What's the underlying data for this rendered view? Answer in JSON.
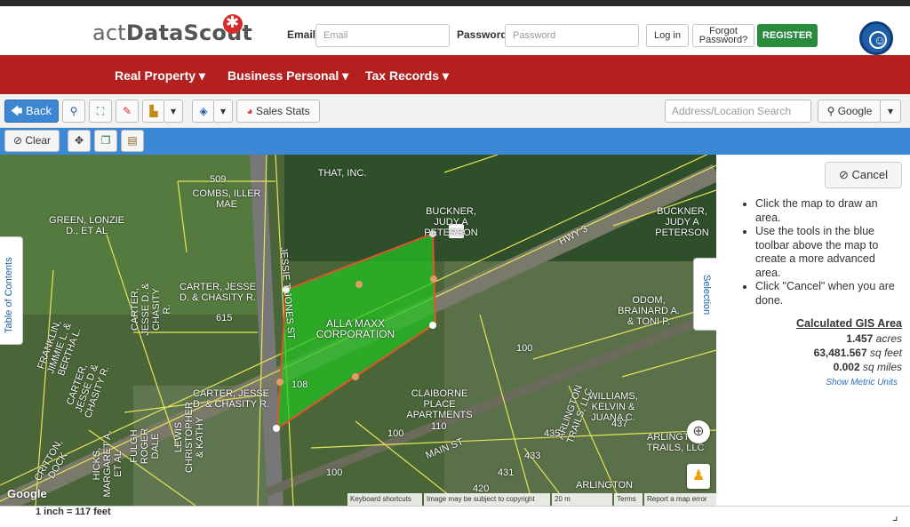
{
  "header": {
    "logo_prefix": "act",
    "logo_main": "DataScout",
    "email_label": "Email",
    "email_placeholder": "Email",
    "password_label": "Password",
    "password_placeholder": "Password",
    "login": "Log in",
    "forgot_line1": "Forgot",
    "forgot_line2": "Password?",
    "register": "REGISTER"
  },
  "nav": {
    "items": [
      "Real Property",
      "Business Personal",
      "Tax Records"
    ]
  },
  "toolbar": {
    "back": "Back",
    "sales_stats": "Sales Stats",
    "search_placeholder": "Address/Location Search",
    "provider": "Google"
  },
  "toolbar2": {
    "clear": "Clear"
  },
  "map": {
    "table_of_contents": "Table of Contents",
    "selection": "Selection",
    "labels": [
      "509",
      "COMBS, ILLER MAE",
      "THAT, INC.",
      "GREEN, LONZIE D., ET AL",
      "BUCKNER, JUDY A PETERSON",
      "BUCKNER, JUDY A PETERSON",
      "CARTER, JESSE D. & CHASITY R.",
      "615",
      "CARTER, JESSE D. & CHASITY R.",
      "ALLA MAXX CORPORATION",
      "108",
      "ODOM, BRAINARD A. & TONI P.",
      "100",
      "CLAIBORNE PLACE APARTMENTS",
      "100",
      "CARTER, JESSE D. & CHASITY R.",
      "WILLIAMS, KELVIN & JUANA C.",
      "ARLINGTON TRAILS, LLC",
      "FULGH ROGER DALE",
      "LEWIS CHRISTOPHER & KATHY",
      "HICKS, MARGARET A, ET AL",
      "FRANKLIN, JIMMIE L. & BERTHA L.",
      "CRITTON, DOCK",
      "100",
      "110",
      "435",
      "433",
      "431",
      "420",
      "437",
      "HWY 3",
      "MAIN ST",
      "ARLINGTON",
      "JESSIE T JONES ST",
      "ARLINGTON TRAILS, LLC",
      "CARTER, JESSE D & CHASITY R."
    ],
    "attribution": [
      "Keyboard shortcuts",
      "Image may be subject to copyright",
      "20 m",
      "Terms",
      "Report a map error"
    ],
    "google": "Google"
  },
  "panel": {
    "cancel": "Cancel",
    "instructions": [
      "Click the map to draw an area.",
      "Use the tools in the blue toolbar above the map to create a more advanced area.",
      "Click \"Cancel\" when you are done."
    ],
    "calc_title": "Calculated GIS Area",
    "acres_value": "1.457",
    "acres_unit": "acres",
    "sqft_value": "63,481.567",
    "sqft_unit": "sq feet",
    "sqmi_value": "0.002",
    "sqmi_unit": "sq miles",
    "metric": "Show Metric Units"
  },
  "scale": "1 inch = 117 feet",
  "colors": {
    "nav": "#b41f1f",
    "toolbar2": "#3b89d6",
    "register": "#2a8a3e",
    "selection": "#22c322"
  }
}
